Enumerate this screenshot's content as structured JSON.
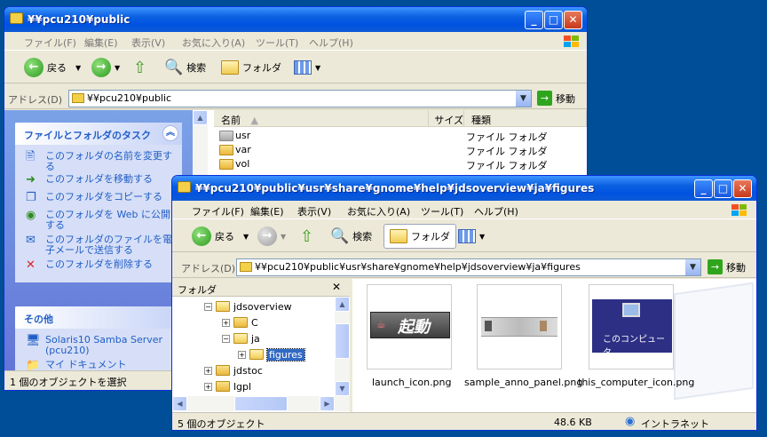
{
  "back_window": {
    "title": "¥¥pcu210¥public",
    "menu": [
      "ファイル(F)",
      "編集(E)",
      "表示(V)",
      "お気に入り(A)",
      "ツール(T)",
      "ヘルプ(H)"
    ],
    "toolbar": {
      "back": "戻る",
      "search": "検索",
      "folders": "フォルダ"
    },
    "address": {
      "label": "アドレス(D)",
      "value": "¥¥pcu210¥public",
      "go": "移動"
    },
    "tasks": {
      "title": "ファイルとフォルダのタスク",
      "items": [
        "このフォルダの名前を変更する",
        "このフォルダを移動する",
        "このフォルダをコピーする",
        "このフォルダを Web に公開する",
        "このフォルダのファイルを電子メールで送信する",
        "このフォルダを削除する"
      ]
    },
    "other": {
      "title": "その他",
      "items": [
        "Solaris10 Samba Server (pcu210)",
        "マイ ドキュメント"
      ]
    },
    "columns": {
      "name": "名前",
      "size": "サイズ",
      "type": "種類"
    },
    "files": [
      {
        "name": "usr",
        "type": "ファイル フォルダ"
      },
      {
        "name": "var",
        "type": "ファイル フォルダ"
      },
      {
        "name": "vol",
        "type": "ファイル フォルダ"
      }
    ],
    "status": "1 個のオブジェクトを選択"
  },
  "front_window": {
    "title": "¥¥pcu210¥public¥usr¥share¥gnome¥help¥jdsoverview¥ja¥figures",
    "menu": [
      "ファイル(F)",
      "編集(E)",
      "表示(V)",
      "お気に入り(A)",
      "ツール(T)",
      "ヘルプ(H)"
    ],
    "toolbar": {
      "back": "戻る",
      "search": "検索",
      "folders": "フォルダ"
    },
    "address": {
      "label": "アドレス(D)",
      "value": "¥¥pcu210¥public¥usr¥share¥gnome¥help¥jdsoverview¥ja¥figures",
      "go": "移動"
    },
    "tree": {
      "title": "フォルダ",
      "items": [
        "jdsoverview",
        "C",
        "ja",
        "figures",
        "jdstoc",
        "lgpl"
      ]
    },
    "thumbnails": [
      {
        "file": "launch_icon.png",
        "caption": "起動"
      },
      {
        "file": "sample_anno_panel.png",
        "caption": ""
      },
      {
        "file": "this_computer_icon.png",
        "caption": "このコンピュータ"
      }
    ],
    "status": {
      "objects": "5 個のオブジェクト",
      "size": "48.6 KB",
      "zone": "イントラネット"
    }
  },
  "colors": {
    "titlebar": "#0053e1",
    "desktop": "#004e98",
    "task_link": "#215dc6",
    "selection": "#316ac5"
  }
}
